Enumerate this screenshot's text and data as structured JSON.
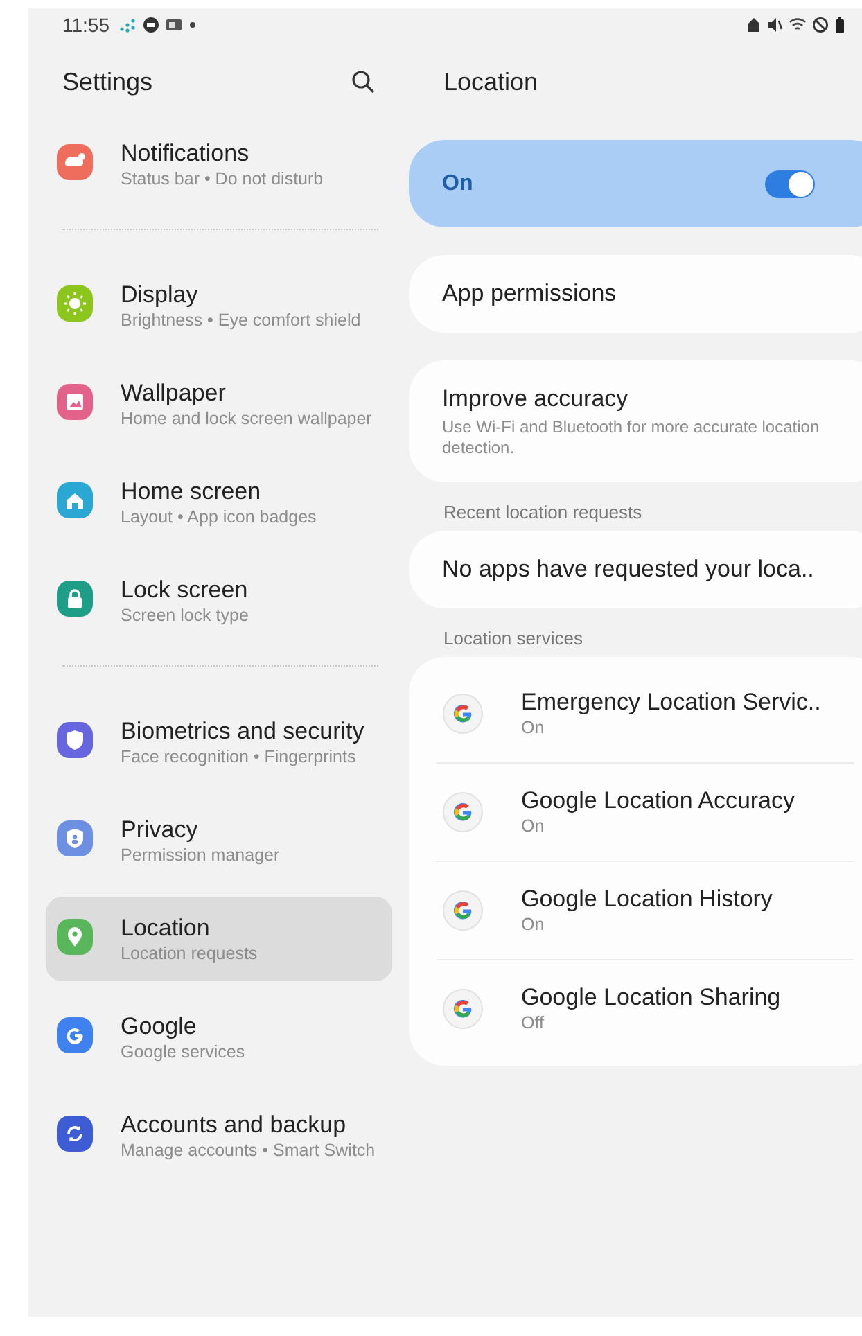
{
  "status_bar": {
    "time": "11:55"
  },
  "sidebar": {
    "title": "Settings",
    "groups": [
      [
        {
          "title": "Notifications",
          "subtitle": "Status bar • Do not disturb",
          "color": "#ee6d5c",
          "selected": false
        }
      ],
      [
        {
          "title": "Display",
          "subtitle": "Brightness • Eye comfort shield",
          "color": "#8cc51c",
          "selected": false
        },
        {
          "title": "Wallpaper",
          "subtitle": "Home and lock screen wallpaper",
          "color": "#e3628c",
          "selected": false
        },
        {
          "title": "Home screen",
          "subtitle": "Layout • App icon badges",
          "color": "#2aa7d3",
          "selected": false
        },
        {
          "title": "Lock screen",
          "subtitle": "Screen lock type",
          "color": "#1f9e87",
          "selected": false
        }
      ],
      [
        {
          "title": "Biometrics and security",
          "subtitle": "Face recognition • Fingerprints",
          "color": "#6766df",
          "selected": false
        },
        {
          "title": "Privacy",
          "subtitle": "Permission manager",
          "color": "#6e90e3",
          "selected": false
        },
        {
          "title": "Location",
          "subtitle": "Location requests",
          "color": "#5ab65a",
          "selected": true
        },
        {
          "title": "Google",
          "subtitle": "Google services",
          "color": "#3f82ef",
          "selected": false
        },
        {
          "title": "Accounts and backup",
          "subtitle": "Manage accounts • Smart Switch",
          "color": "#3e5cd3",
          "selected": false
        }
      ]
    ]
  },
  "detail": {
    "title": "Location",
    "master_switch": {
      "label": "On",
      "on": true
    },
    "items": [
      {
        "title": "App permissions"
      },
      {
        "title": "Improve accuracy",
        "subtitle": "Use Wi-Fi and Bluetooth for more accurate location detection."
      }
    ],
    "recent_requests": {
      "header": "Recent location requests",
      "text": "No apps have requested your loca.."
    },
    "location_services": {
      "header": "Location services",
      "items": [
        {
          "title": "Emergency Location Servic..",
          "status": "On"
        },
        {
          "title": "Google Location Accuracy",
          "status": "On"
        },
        {
          "title": "Google Location History",
          "status": "On"
        },
        {
          "title": "Google Location Sharing",
          "status": "Off"
        }
      ]
    }
  }
}
